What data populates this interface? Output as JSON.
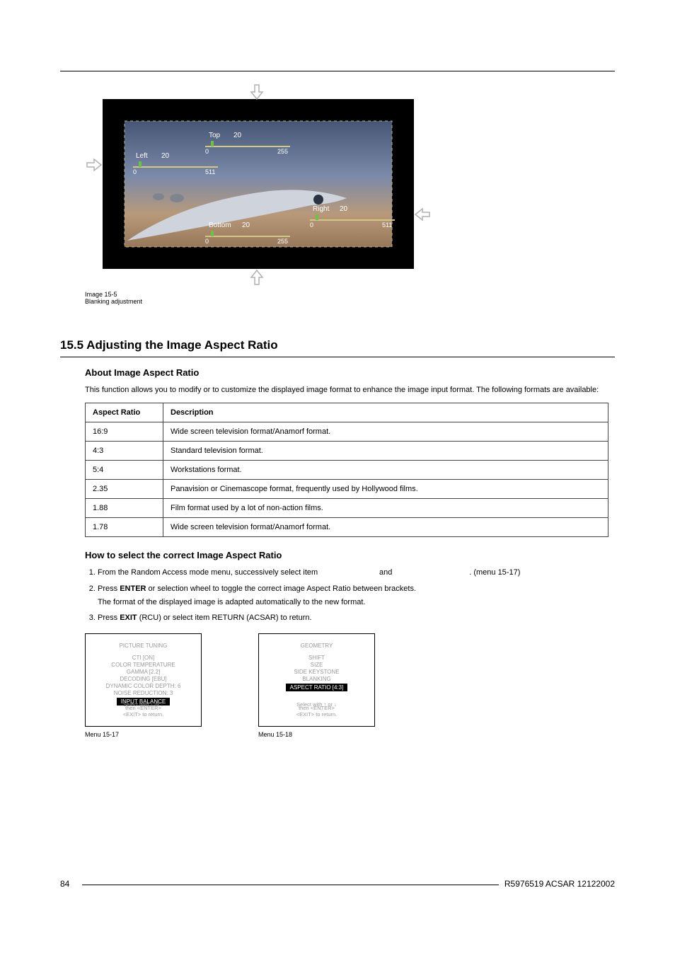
{
  "figure": {
    "caption_line1": "Image 15-5",
    "caption_line2": "Blanking adjustment",
    "labels": {
      "top": "Top",
      "left": "Left",
      "right": "Right",
      "bottom": "Bottom",
      "top_val": "20",
      "left_val": "20",
      "right_val": "20",
      "bottom_val": "20",
      "z255_a": "255",
      "z511_a": "511",
      "z511_b": "511",
      "z255_b": "255",
      "zero": "0"
    }
  },
  "section": {
    "number_title": "15.5 Adjusting the Image Aspect Ratio",
    "about_heading": "About Image Aspect Ratio",
    "about_para": "This function allows you to modify or to customize the displayed image format to enhance the image input format.  The following formats are available:",
    "table": {
      "header": {
        "col1": "Aspect Ratio",
        "col2": "Description"
      },
      "rows": [
        {
          "ratio": "16:9",
          "desc": "Wide screen television format/Anamorf format."
        },
        {
          "ratio": "4:3",
          "desc": "Standard television format."
        },
        {
          "ratio": "5:4",
          "desc": "Workstations format."
        },
        {
          "ratio": "2.35",
          "desc": "Panavision or Cinemascope format, frequently used by Hollywood films."
        },
        {
          "ratio": "1.88",
          "desc": "Film format used by a lot of non-action films."
        },
        {
          "ratio": "1.78",
          "desc": "Wide screen television format/Anamorf format."
        }
      ]
    },
    "howto_heading": "How to select the correct Image Aspect Ratio",
    "steps": {
      "s1_a": "From the Random Access mode menu, successively select item ",
      "s1_b": " and ",
      "s1_c": ". (menu 15-17)",
      "s2_a": "Press ",
      "s2_enter": "ENTER",
      "s2_b": " or selection wheel to toggle the correct image Aspect Ratio between brackets.",
      "s2_sub": "The format of the displayed image is adapted automatically to the new format.",
      "s3_a": "Press ",
      "s3_exit": "EXIT",
      "s3_b": " (RCU) or select item RETURN (ACSAR) to return."
    },
    "menus": {
      "m17": {
        "caption": "Menu 15-17",
        "title": "PICTURE TUNING",
        "items": [
          "CTI [ON]",
          "COLOR TEMPERATURE",
          "GAMMA [2.2]",
          "DECODING [EBU]",
          "DYNAMIC COLOR DEPTH: 6",
          "NOISE REDUCTION: 3"
        ],
        "highlight": "INPUT BALANCE",
        "scroll": "Select with ↑ or ↓",
        "enter": "then <ENTER>",
        "return": "<EXIT> to return."
      },
      "m18": {
        "caption": "Menu 15-18",
        "title": "GEOMETRY",
        "items": [
          "SHIFT",
          "SIZE",
          "SIDE KEYSTONE",
          "BLANKING"
        ],
        "highlight": "ASPECT RATIO [4:3]",
        "scroll": "Select with ↑ or ↓",
        "enter": "then <ENTER>",
        "return": "<EXIT> to return."
      }
    }
  },
  "footer": {
    "page": "84",
    "docref": "R5976519 ACSAR 12122002"
  }
}
